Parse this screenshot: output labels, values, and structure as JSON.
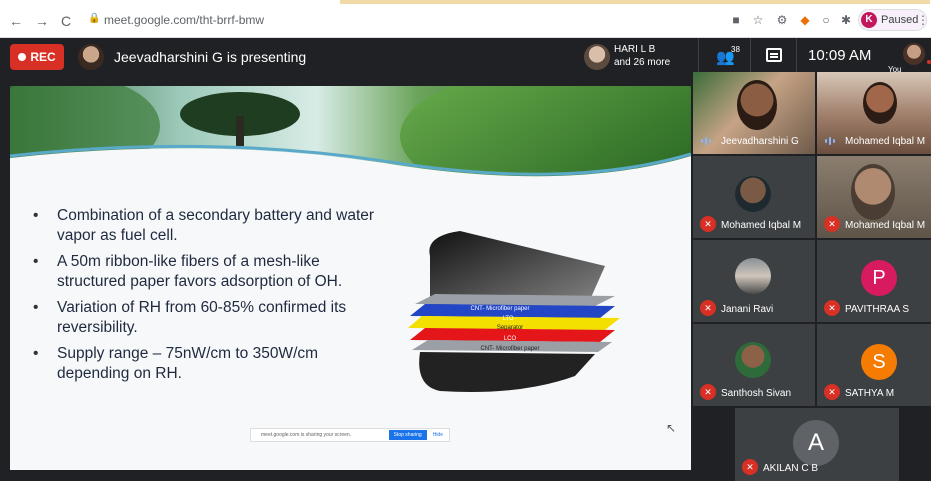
{
  "browser": {
    "url": "meet.google.com/tht-brrf-bmw",
    "profile_letter": "K",
    "profile_status": "Paused",
    "nav": {
      "back": "←",
      "forward": "→",
      "reload": "C"
    }
  },
  "meet_bar": {
    "rec_label": "REC",
    "presenting_text": "Jeevadharshini G is presenting",
    "top_participant_name": "HARI L B",
    "top_participant_more": "and 26 more",
    "participant_count": "38",
    "time": "10:09 AM",
    "you_label": "You"
  },
  "slide": {
    "bullets": [
      "Combination of a secondary battery and water vapor as  fuel cell.",
      "A 50m ribbon-like fibers of a mesh-like structured paper favors adsorption of OH.",
      "Variation of RH from 60-85% confirmed its reversibility.",
      "Supply range – 75nW/cm to 350W/cm depending on RH."
    ],
    "diagram_labels": {
      "cnt_top": "CNT- Microfiber paper",
      "lto": "LTO",
      "separator": "Separator",
      "lco": "LCO",
      "cnt_bottom": "CNT- Microfiber paper"
    },
    "share_banner": {
      "message": "meet.google.com is sharing your screen.",
      "stop": "Stop sharing",
      "hide": "Hide"
    }
  },
  "participants": [
    {
      "name": "Jeevadharshini G",
      "state": "speaking"
    },
    {
      "name": "Mohamed Iqbal M",
      "state": "speaking"
    },
    {
      "name": "Mohamed Iqbal M",
      "state": "muted"
    },
    {
      "name": "Mohamed Iqbal M",
      "state": "muted"
    },
    {
      "name": "Janani Ravi",
      "state": "muted"
    },
    {
      "name": "PAVITHRAA S",
      "state": "muted",
      "letter": "P",
      "color": "#d81b60"
    },
    {
      "name": "Santhosh Sivan",
      "state": "muted"
    },
    {
      "name": "SATHYA M",
      "state": "muted",
      "letter": "S",
      "color": "#f57c00"
    },
    {
      "name": "AKILAN C B",
      "state": "muted",
      "letter": "A",
      "color": "#5f6368"
    }
  ],
  "colors": {
    "rec": "#d93025",
    "meet_bg": "#202124",
    "tile_bg": "#3c4043",
    "accent": "#1a73e8"
  }
}
